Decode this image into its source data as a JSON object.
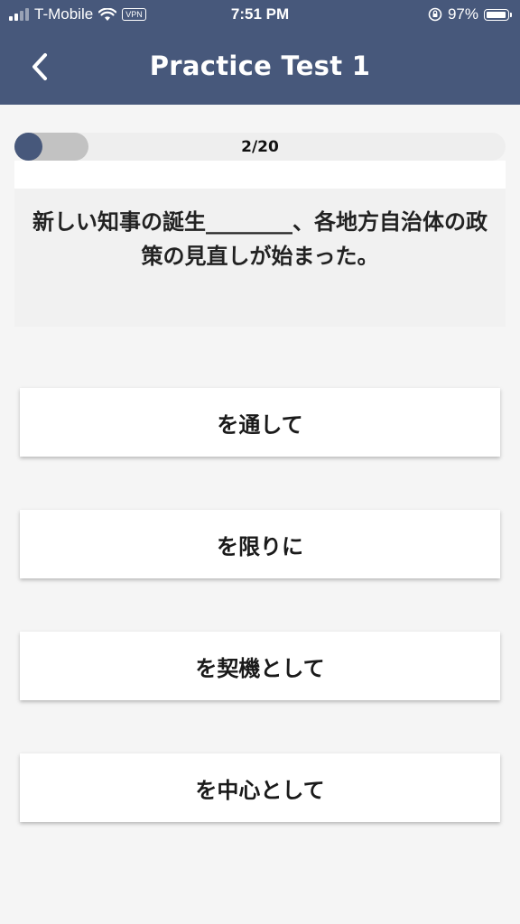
{
  "status_bar": {
    "carrier": "T-Mobile",
    "vpn": "VPN",
    "time": "7:51 PM",
    "battery": "97%"
  },
  "header": {
    "title": "Practice Test 1"
  },
  "progress": {
    "label": "2/20",
    "current": 2,
    "total": 20
  },
  "question": {
    "text": "新しい知事の誕生________、各地方自治体の政策の見直しが始まった。"
  },
  "answers": [
    {
      "label": "を通して"
    },
    {
      "label": "を限りに"
    },
    {
      "label": "を契機として"
    },
    {
      "label": "を中心として"
    }
  ],
  "colors": {
    "primary": "#47587b",
    "background": "#f5f5f5"
  }
}
